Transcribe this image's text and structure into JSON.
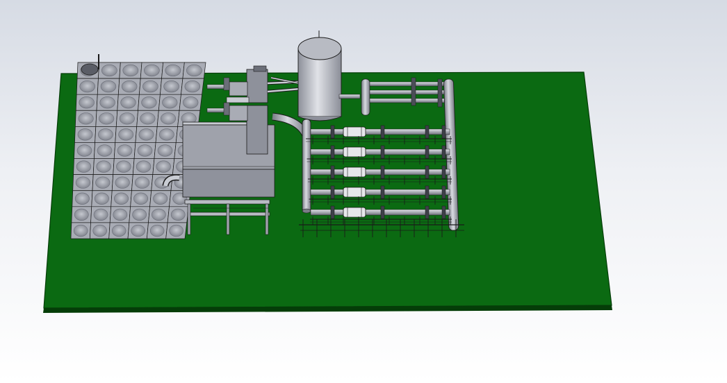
{
  "viewport": {
    "background_top": "#d6dbe4",
    "background_bottom": "#ffffff"
  },
  "model": {
    "base_plate_color": "#0b6a12",
    "base_plate_edge_color": "#053d08",
    "metal_color": "#a9acb5",
    "metal_dark_color": "#6b6e78",
    "metal_light_color": "#d7d9df",
    "outline_color": "#1a1a1a",
    "components": [
      "base-plate",
      "modular-water-tank",
      "pump-skid",
      "pressure-vessel",
      "main-header-pipe",
      "distribution-manifold",
      "filter-lines"
    ],
    "filter_line_count": 5,
    "tank_panel_rows": 11,
    "tank_panel_cols": 6
  }
}
